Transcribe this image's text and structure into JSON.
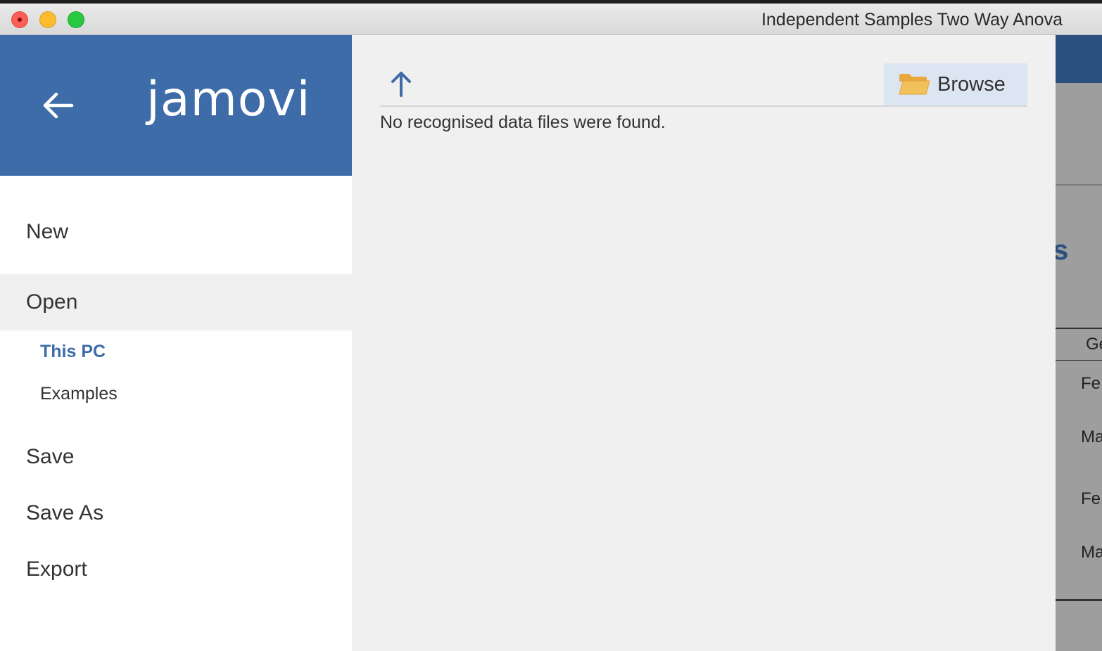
{
  "window": {
    "title": "Independent Samples Two Way Anova"
  },
  "brand": {
    "logo_text": "jamovi",
    "color": "#3e6ca8"
  },
  "menu": {
    "new": "New",
    "open": "Open",
    "open_sub": {
      "this_pc": "This PC",
      "examples": "Examples"
    },
    "save": "Save",
    "save_as": "Save As",
    "export": "Export"
  },
  "browser": {
    "browse_label": "Browse",
    "empty_message": "No recognised data files were found."
  },
  "background_app": {
    "heading_fragment": "s",
    "column_fragment": "Ge",
    "rows": [
      "Fe",
      "Ma",
      "Fe",
      "Ma"
    ]
  },
  "icons": {
    "back": "back-arrow-icon",
    "up": "up-arrow-icon",
    "folder": "folder-icon"
  },
  "colors": {
    "accent": "#3e6ca8",
    "folder": "#f3c15c",
    "browse_bg": "#dce6f2"
  }
}
